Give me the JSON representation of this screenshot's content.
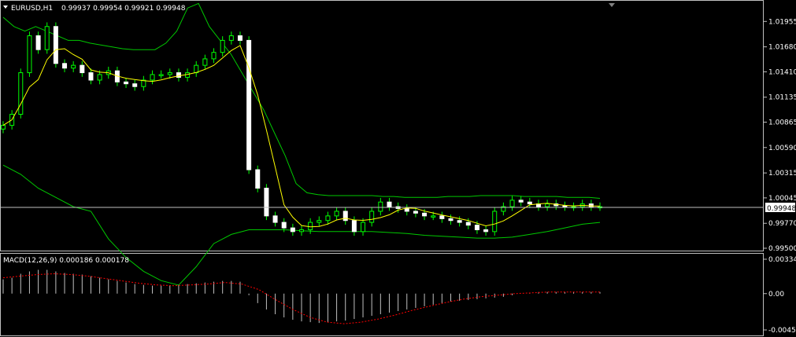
{
  "window": {
    "symbol_header": "EURUSD,H1",
    "ohlc": "0.99937 0.99954 0.99921 0.99948",
    "current_price": "0.99948"
  },
  "price_axis": {
    "ticks": [
      "1.01955",
      "1.01680",
      "1.01410",
      "1.01135",
      "1.00865",
      "1.00590",
      "1.00315",
      "1.00045",
      "0.99770",
      "0.99500"
    ],
    "range": [
      0.995,
      1.02
    ]
  },
  "macd_panel": {
    "label": "MACD(12,26,9) 0.000186 0.000178",
    "ticks": [
      "0.003344",
      "0.00",
      "-0.00458"
    ],
    "range": [
      -0.00458,
      0.003344
    ]
  },
  "colors": {
    "background": "#000000",
    "candle": "#ffffff",
    "wick": "#00ff00",
    "bollinger": "#00c800",
    "moving_average": "#ffff00",
    "macd_signal": "#ff0000",
    "macd_histogram": "#c0c0c0",
    "price_line": "#c0c0c0"
  },
  "chart_data": [
    {
      "type": "candlestick",
      "title": "EURUSD,H1",
      "indicators": [
        "Bollinger Bands",
        "Moving Average"
      ],
      "close": [
        1.0083,
        1.0095,
        1.014,
        1.018,
        1.0165,
        1.019,
        1.015,
        1.0145,
        1.0148,
        1.014,
        1.0132,
        1.0138,
        1.0142,
        1.013,
        1.0128,
        1.0125,
        1.0132,
        1.0138,
        1.0138,
        1.014,
        1.0135,
        1.014,
        1.0148,
        1.0155,
        1.0162,
        1.0175,
        1.018,
        1.0175,
        1.0035,
        1.0015,
        0.9985,
        0.9978,
        0.9972,
        0.9968,
        0.997,
        0.9978,
        0.998,
        0.9985,
        0.999,
        0.998,
        0.9968,
        0.9978,
        0.999,
        1.0,
        0.9995,
        0.9993,
        0.999,
        0.9988,
        0.9985,
        0.9985,
        0.9982,
        0.998,
        0.9978,
        0.9975,
        0.997,
        0.9968,
        0.999,
        0.9995,
        1.0002,
        1.0,
        0.9998,
        0.9995,
        0.9998,
        0.9996,
        0.9995,
        0.9995,
        0.9998,
        0.9995,
        0.9995
      ],
      "bollinger_upper": [
        1.02,
        1.019,
        1.0185,
        1.019,
        1.0185,
        1.018,
        1.0175,
        1.0175,
        1.0172,
        1.017,
        1.0168,
        1.0166,
        1.0165,
        1.0165,
        1.0165,
        1.0172,
        1.0185,
        1.021,
        1.0215,
        1.019,
        1.0175,
        1.016,
        1.014,
        1.012,
        1.01,
        1.0075,
        1.005,
        1.002,
        1.001,
        1.0008,
        1.0007,
        1.0007,
        1.0007,
        1.0007,
        1.0007,
        1.0006,
        1.0006,
        1.0005,
        1.0005,
        1.0005,
        1.0005,
        1.0006,
        1.0006,
        1.0006,
        1.0007,
        1.0007,
        1.0007,
        1.0007,
        1.0006,
        1.0006,
        1.0006,
        1.0006,
        1.0005,
        1.0005,
        1.0005,
        1.0004
      ],
      "bollinger_lower": [
        1.004,
        1.003,
        1.0015,
        1.0005,
        0.9995,
        0.999,
        0.996,
        0.994,
        0.9925,
        0.9915,
        0.991,
        0.993,
        0.9955,
        0.9965,
        0.997,
        0.997,
        0.997,
        0.9969,
        0.9968,
        0.9968,
        0.9968,
        0.9968,
        0.9967,
        0.9966,
        0.9964,
        0.9963,
        0.9962,
        0.9961,
        0.9961,
        0.9962,
        0.9965,
        0.9968,
        0.9972,
        0.9976,
        0.9978
      ]
    },
    {
      "type": "bar",
      "title": "MACD(12,26,9) 0.000186 0.000178",
      "series": [
        {
          "name": "MACD",
          "values": [
            0.0018,
            0.002,
            0.0025,
            0.0028,
            0.003,
            0.003,
            0.0028,
            0.0026,
            0.0025,
            0.0024,
            0.0022,
            0.002,
            0.0018,
            0.0016,
            0.0014,
            0.0012,
            0.0011,
            0.001,
            0.001,
            0.001,
            0.0011,
            0.0012,
            0.0013,
            0.0014,
            0.0015,
            0.0016,
            0.0016,
            0.0015,
            -0.0002,
            -0.0012,
            -0.002,
            -0.0026,
            -0.003,
            -0.0033,
            -0.0035,
            -0.0036,
            -0.0037,
            -0.0036,
            -0.0035,
            -0.0034,
            -0.0032,
            -0.003,
            -0.0028,
            -0.0026,
            -0.0024,
            -0.0022,
            -0.002,
            -0.0018,
            -0.0016,
            -0.0014,
            -0.0012,
            -0.001,
            -0.0009,
            -0.0008,
            -0.0007,
            -0.0006,
            -0.0005,
            -0.0004,
            -0.0002,
            0.0,
            0.0001,
            0.0002,
            0.0002,
            0.0002,
            0.0002,
            0.0002,
            0.0002,
            0.0002,
            0.0002
          ]
        },
        {
          "name": "Signal",
          "values": [
            0.002,
            0.0022,
            0.0024,
            0.0025,
            0.0024,
            0.0022,
            0.0019,
            0.0016,
            0.0013,
            0.0011,
            0.001,
            0.0011,
            0.0012,
            0.0014,
            0.0012,
            0.0005,
            -0.0008,
            -0.002,
            -0.003,
            -0.0036,
            -0.0038,
            -0.0036,
            -0.0032,
            -0.0027,
            -0.0021,
            -0.0016,
            -0.0011,
            -0.0007,
            -0.0004,
            -0.0002,
            0.0,
            0.0001,
            0.0002,
            0.0002,
            0.0002,
            0.0002
          ]
        }
      ]
    }
  ]
}
